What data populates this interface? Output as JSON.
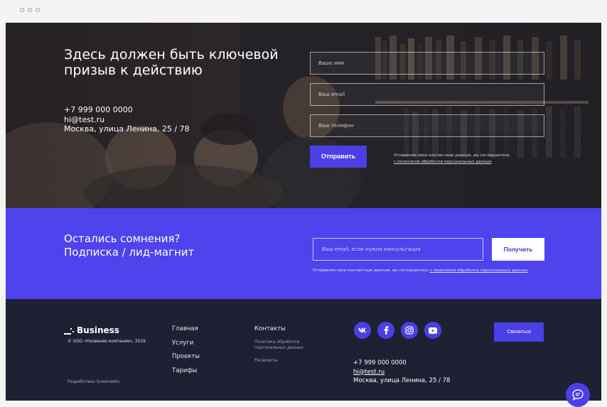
{
  "hero": {
    "title": "Здесь должен быть ключевой призыв к действию",
    "phone": "+7 999 000 0000",
    "email": "hi@test.ru",
    "address": "Москва, улица Ленина, 25 / 78",
    "form": {
      "name_placeholder": "Ваше имя",
      "email_placeholder": "Ваш email",
      "phone_placeholder": "Ваш телефон",
      "submit_label": "Отправить",
      "consent_text": "Отправляя свои контактные данные, вы соглашаетесь",
      "consent_link": "с политикой обработки персональных данных"
    }
  },
  "subscribe": {
    "title_line1": "Остались сомнения?",
    "title_line2": "Подписка / лид-магнит",
    "input_placeholder": "Ваш email, если нужна консультация",
    "button_label": "Получить",
    "consent_text": "Отправляя свои контактные данные, вы соглашаетесь",
    "consent_link": "с политикой обработки персональных данных"
  },
  "footer": {
    "brand": "Business",
    "copyright": "© ООО «Название компании», 2019",
    "developer": "Разработано Svoemedia",
    "nav": [
      "Главная",
      "Услуги",
      "Проекты",
      "Тарифы"
    ],
    "contacts_title": "Контакты",
    "policy_link": "Политика обработки персональных данных",
    "requisites_link": "Реквизиты",
    "socials": [
      "vk-icon",
      "facebook-icon",
      "instagram-icon",
      "youtube-icon"
    ],
    "phone": "+7 999 000 0000",
    "email": "hi@test.ru",
    "address": "Москва, улица Ленина, 25 / 78",
    "contact_button": "Связаться"
  },
  "colors": {
    "accent": "#4b3fe6",
    "subscribe_bg": "#4e43ec",
    "footer_bg": "#1d2133"
  }
}
